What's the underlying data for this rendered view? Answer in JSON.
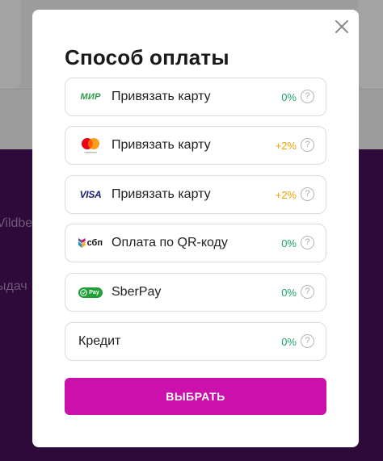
{
  "background": {
    "line1": "Vildbe",
    "line2": "ыдач"
  },
  "modal": {
    "title": "Способ оплаты",
    "close_icon": "close-icon",
    "submit_label": "ВЫБРАТЬ"
  },
  "options": [
    {
      "icon": "mir-logo-icon",
      "icon_text": "МИР",
      "label": "Привязать карту",
      "fee": "0%"
    },
    {
      "icon": "mastercard-logo-icon",
      "icon_text": "mastercard",
      "label": "Привязать карту",
      "fee": "+2%"
    },
    {
      "icon": "visa-logo-icon",
      "icon_text": "VISA",
      "label": "Привязать карту",
      "fee": "+2%"
    },
    {
      "icon": "sbp-logo-icon",
      "icon_text": "сбп",
      "label": "Оплата по QR-коду",
      "fee": "0%"
    },
    {
      "icon": "sberpay-logo-icon",
      "icon_text": "Pay",
      "label": "SberPay",
      "fee": "0%"
    },
    {
      "icon": "",
      "icon_text": "",
      "label": "Кредит",
      "fee": "0%"
    }
  ],
  "help_glyph": "?",
  "colors": {
    "accent": "#cb11ab",
    "fee_zero": "#1aa36b",
    "fee_plus": "#f0a000",
    "overlay_purple": "#2e0a3b"
  }
}
